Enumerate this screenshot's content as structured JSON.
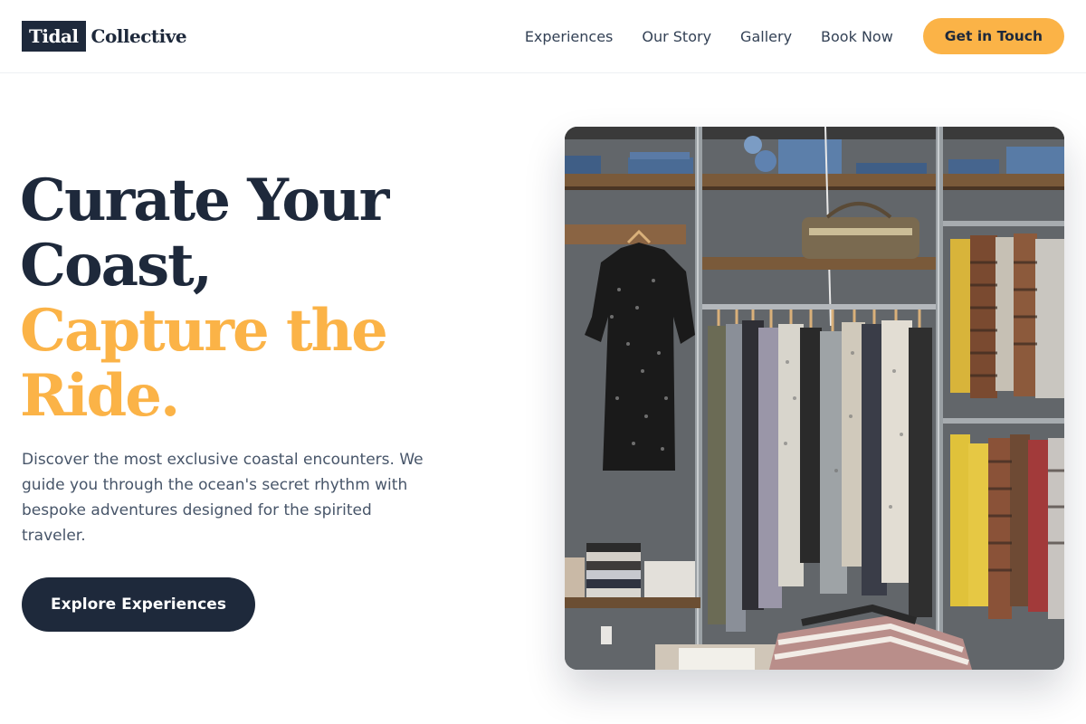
{
  "brand": {
    "logo_box_text": "Tidal",
    "logo_rest_text": "Collective"
  },
  "nav": {
    "links": [
      "Experiences",
      "Our Story",
      "Gallery",
      "Book Now"
    ],
    "cta_label": "Get in Touch"
  },
  "hero": {
    "title_line1": "Curate Your",
    "title_line2": "Coast,",
    "title_accent_line1": "Capture the",
    "title_accent_line2": "Ride.",
    "description": "Discover the most exclusive coastal encounters. We guide you through the ocean's secret rhythm with bespoke adventures designed for the spirited traveler.",
    "button_label": "Explore Experiences"
  },
  "colors": {
    "primary_dark": "#1e293b",
    "accent": "#fbb347",
    "body_text": "#475569"
  }
}
